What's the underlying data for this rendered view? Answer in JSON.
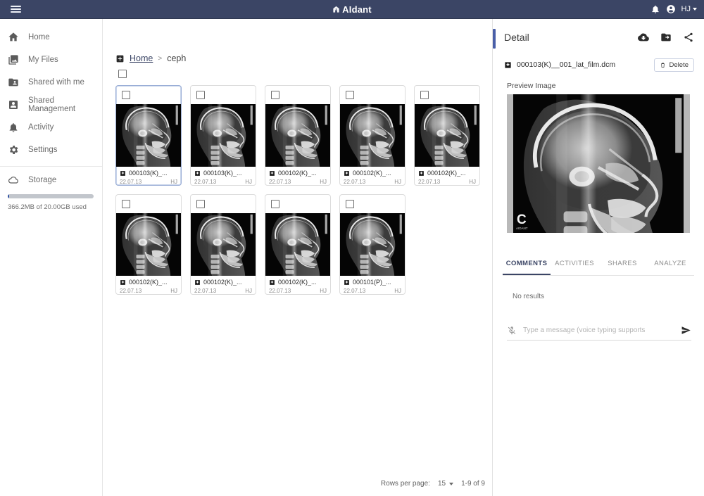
{
  "topbar": {
    "menu_icon": "hamburger-menu-icon",
    "brand": "AIdant",
    "brand_icon": "aidant-logo-icon",
    "notifications_icon": "bell-icon",
    "account_icon": "account-circle-icon",
    "user_initials": "HJ"
  },
  "sidebar": {
    "items": [
      {
        "label": "Home",
        "icon": "home-icon"
      },
      {
        "label": "My Files",
        "icon": "photo-library-icon"
      },
      {
        "label": "Shared with me",
        "icon": "folder-shared-icon"
      },
      {
        "label": "Shared Management",
        "icon": "account-box-icon"
      },
      {
        "label": "Activity",
        "icon": "bell-icon"
      },
      {
        "label": "Settings",
        "icon": "gear-icon"
      }
    ],
    "storage": {
      "label": "Storage",
      "icon": "cloud-icon",
      "usage_text": "366.2MB of 20.00GB used",
      "percent_used": 1.8,
      "fill_color": "#2f51a3",
      "track_color": "#c2c6cc"
    }
  },
  "main": {
    "breadcrumb": {
      "add_icon": "add-box-icon",
      "root": "Home",
      "separator": ">",
      "current": "ceph"
    },
    "select_all_checkbox": "select-all-checkbox",
    "cards": [
      {
        "name": "000103(K)_...",
        "date": "22.07.13",
        "owner": "HJ",
        "selected": true
      },
      {
        "name": "000103(K)_...",
        "date": "22.07.13",
        "owner": "HJ",
        "selected": false
      },
      {
        "name": "000102(K)_...",
        "date": "22.07.13",
        "owner": "HJ",
        "selected": false
      },
      {
        "name": "000102(K)_...",
        "date": "22.07.13",
        "owner": "HJ",
        "selected": false
      },
      {
        "name": "000102(K)_...",
        "date": "22.07.13",
        "owner": "HJ",
        "selected": false
      },
      {
        "name": "000102(K)_...",
        "date": "22.07.13",
        "owner": "HJ",
        "selected": false
      },
      {
        "name": "000102(K)_...",
        "date": "22.07.13",
        "owner": "HJ",
        "selected": false
      },
      {
        "name": "000102(K)_...",
        "date": "22.07.13",
        "owner": "HJ",
        "selected": false
      },
      {
        "name": "000101(P)_...",
        "date": "22.07.13",
        "owner": "HJ",
        "selected": false
      }
    ],
    "paginator": {
      "rows_per_page_label": "Rows per page:",
      "rows_per_page_value": "15",
      "range_label": "1-9 of 9"
    }
  },
  "detail": {
    "title": "Detail",
    "accent_color": "#4a5fa8",
    "actions": [
      {
        "icon": "cloud-download-icon"
      },
      {
        "icon": "move-to-folder-icon"
      },
      {
        "icon": "share-icon"
      }
    ],
    "file": {
      "icon": "dicom-file-icon",
      "name": "000103(K)__001_lat_film.dcm",
      "delete_label": "Delete",
      "delete_icon": "trash-icon"
    },
    "preview": {
      "label": "Preview Image",
      "marker": "C",
      "marker_sub": "AIDANT"
    },
    "tabs": [
      {
        "label": "COMMENTS",
        "active": true
      },
      {
        "label": "ACTIVITIES",
        "active": false
      },
      {
        "label": "SHARES",
        "active": false
      },
      {
        "label": "ANALYZE",
        "active": false
      }
    ],
    "empty_text": "No results",
    "message": {
      "mic_icon": "mic-off-icon",
      "placeholder": "Type a message (voice typing supports",
      "value": "",
      "send_icon": "send-icon"
    }
  }
}
